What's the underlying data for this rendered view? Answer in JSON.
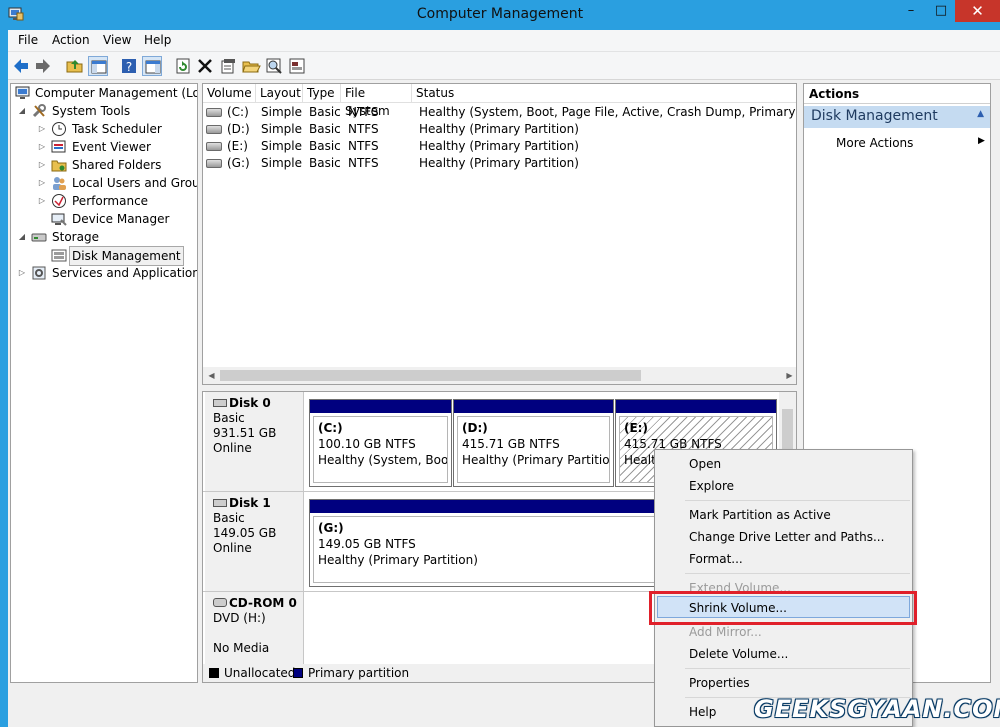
{
  "window": {
    "title": "Computer Management",
    "minimize": "–",
    "maximize": "□",
    "close": "✕"
  },
  "menu": [
    "File",
    "Action",
    "View",
    "Help"
  ],
  "toolbar": [
    "back-icon",
    "forward-icon",
    "up-folder-icon",
    "show-hide-tree-icon",
    "help-icon",
    "show-hide-action-pane-icon",
    "refresh-icon",
    "delete-icon",
    "properties-icon",
    "open-folder-icon",
    "search-icon",
    "disk-properties-icon"
  ],
  "tree": {
    "root": "Computer Management (Local",
    "system_tools": "System Tools",
    "task_scheduler": "Task Scheduler",
    "event_viewer": "Event Viewer",
    "shared_folders": "Shared Folders",
    "local_users": "Local Users and Groups",
    "performance": "Performance",
    "device_manager": "Device Manager",
    "storage": "Storage",
    "disk_management": "Disk Management",
    "services": "Services and Applications"
  },
  "volumes": {
    "columns": [
      "Volume",
      "Layout",
      "Type",
      "File System",
      "Status"
    ],
    "rows": [
      [
        "(C:)",
        "Simple",
        "Basic",
        "NTFS",
        "Healthy (System, Boot, Page File, Active, Crash Dump, Primary Partition)"
      ],
      [
        "(D:)",
        "Simple",
        "Basic",
        "NTFS",
        "Healthy (Primary Partition)"
      ],
      [
        "(E:)",
        "Simple",
        "Basic",
        "NTFS",
        "Healthy (Primary Partition)"
      ],
      [
        "(G:)",
        "Simple",
        "Basic",
        "NTFS",
        "Healthy (Primary Partition)"
      ]
    ]
  },
  "disks": {
    "disk0": {
      "name": "Disk 0",
      "type": "Basic",
      "size": "931.51 GB",
      "state": "Online",
      "parts": [
        {
          "name": "(C:)",
          "size": "100.10 GB NTFS",
          "status": "Healthy (System, Boot, P"
        },
        {
          "name": "(D:)",
          "size": "415.71 GB NTFS",
          "status": "Healthy (Primary Partition)"
        },
        {
          "name": "(E:)",
          "size": "415.71 GB NTFS",
          "status": "Health"
        }
      ]
    },
    "disk1": {
      "name": "Disk 1",
      "type": "Basic",
      "size": "149.05 GB",
      "state": "Online",
      "parts": [
        {
          "name": "(G:)",
          "size": "149.05 GB NTFS",
          "status": "Healthy (Primary Partition)"
        }
      ]
    },
    "cdrom": {
      "name": "CD-ROM 0",
      "drive": "DVD (H:)",
      "media": "No Media"
    }
  },
  "legend": {
    "unallocated": "Unallocated",
    "primary": "Primary partition",
    "unallocated_color": "#000000",
    "primary_color": "#00007f"
  },
  "actions": {
    "header": "Actions",
    "selected": "Disk Management",
    "more": "More Actions"
  },
  "context_menu": {
    "open": "Open",
    "explore": "Explore",
    "mark_active": "Mark Partition as Active",
    "change_letter": "Change Drive Letter and Paths...",
    "format": "Format...",
    "extend": "Extend Volume...",
    "shrink": "Shrink Volume...",
    "add_mirror": "Add Mirror...",
    "delete": "Delete Volume...",
    "properties": "Properties",
    "help": "Help"
  },
  "watermark": "GEEKSGYAAN.COM"
}
